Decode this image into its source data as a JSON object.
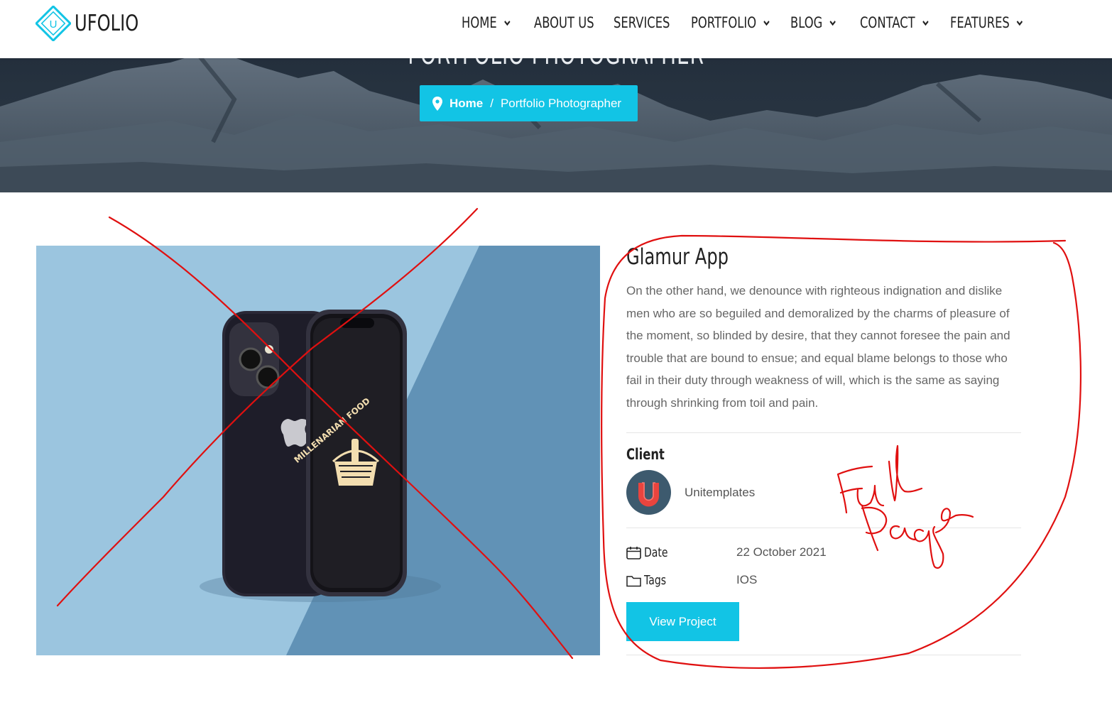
{
  "brand": {
    "name": "UFOLIO",
    "logo_letter": "U",
    "accent": "#12c4e5"
  },
  "nav": {
    "items": [
      {
        "label": "HOME",
        "has_dropdown": true
      },
      {
        "label": "ABOUT US",
        "has_dropdown": false
      },
      {
        "label": "SERVICES",
        "has_dropdown": false
      },
      {
        "label": "PORTFOLIO",
        "has_dropdown": true
      },
      {
        "label": "BLOG",
        "has_dropdown": true
      },
      {
        "label": "CONTACT",
        "has_dropdown": true
      },
      {
        "label": "FEATURES",
        "has_dropdown": true
      }
    ]
  },
  "hero": {
    "title": "PORTFOLIO PHOTOGRAPHER",
    "breadcrumb": {
      "home": "Home",
      "separator": "/",
      "current": "Portfolio Photographer"
    }
  },
  "project": {
    "image_logo_text": "MILLENARIAN FOOD",
    "title": "Glamur App",
    "description": "On the other hand, we denounce with righteous indignation and dislike men who are so beguiled and demoralized by the charms of pleasure of the moment, so blinded by desire, that they cannot foresee the pain and trouble that are bound to ensue; and equal blame belongs to those who fail in their duty through weakness of will, which is the same as saying through shrinking from toil and pain.",
    "client_label": "Client",
    "client_name": "Unitemplates",
    "date_label": "Date",
    "date_value": "22 October 2021",
    "tags_label": "Tags",
    "tags_value": "IOS",
    "button_label": "View Project"
  },
  "annotation": {
    "handwritten_text": "Full page",
    "color": "#e01010"
  }
}
